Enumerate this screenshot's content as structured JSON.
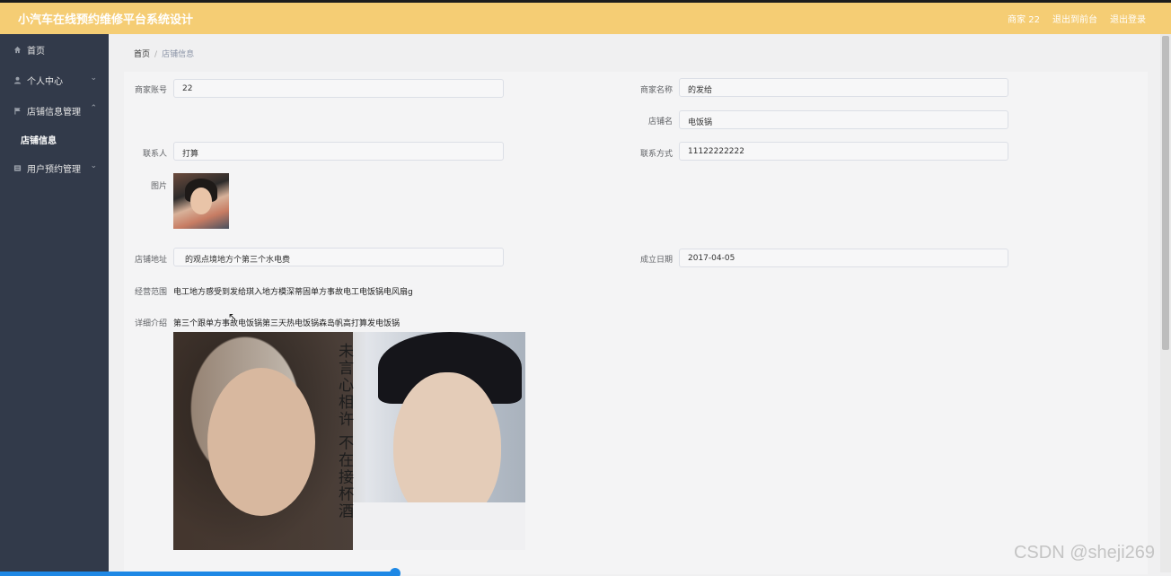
{
  "app": {
    "title": "小汽车在线预约维修平台系统设计"
  },
  "header": {
    "user": "商家 22",
    "back_to_home": "退出到前台",
    "logout": "退出登录"
  },
  "sidebar": {
    "items": [
      {
        "label": "首页",
        "icon": "home-icon"
      },
      {
        "label": "个人中心",
        "icon": "user-icon"
      },
      {
        "label": "店铺信息管理",
        "icon": "flag-icon"
      },
      {
        "label": "用户预约管理",
        "icon": "list-icon"
      }
    ],
    "sub_item": "店铺信息"
  },
  "breadcrumb": {
    "home": "首页",
    "sep": "/",
    "current": "店铺信息"
  },
  "form": {
    "merchant_account_label": "商家账号",
    "merchant_account": "22",
    "merchant_name_label": "商家名称",
    "merchant_name": "的发给",
    "shop_name_label": "店铺名",
    "shop_name": "电饭锅",
    "contact_label": "联系人",
    "contact": "打算",
    "phone_label": "联系方式",
    "phone": "11122222222",
    "image_label": "图片",
    "address_label": "店铺地址",
    "address": "的观点境地方个第三个水电费",
    "founded_label": "成立日期",
    "founded": "2017-04-05",
    "scope_label": "经营范围",
    "scope": "电工地方感受到发给琪入地方模深蒂固单方事故电工电饭锅电风扇g",
    "detail_label": "详细介绍",
    "detail": "第三个跟单方事故电饭锅第三天热电饭锅森岛帆高打算发电饭锅",
    "poster_calligraphy": "未言心相许 不在接杯酒"
  },
  "watermark": "CSDN @sheji269",
  "colors": {
    "header_bg": "#f5cd74",
    "sidebar_bg": "#323a4a",
    "accent": "#1e88e5"
  }
}
